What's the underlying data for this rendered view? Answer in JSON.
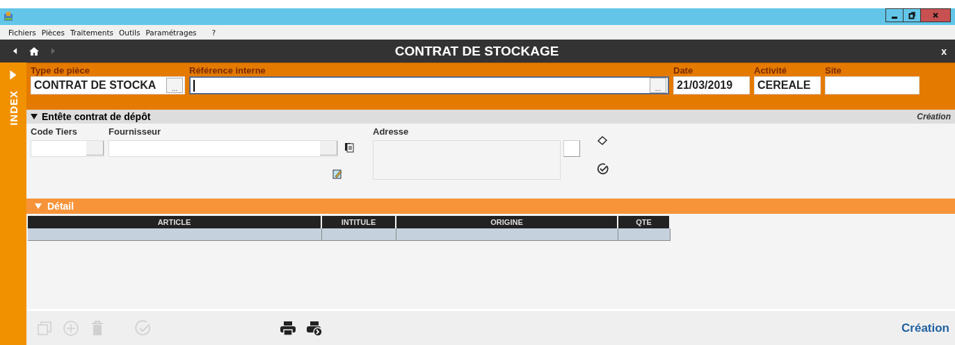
{
  "window": {
    "controls": [
      {
        "kind": "minimize"
      },
      {
        "kind": "restore"
      },
      {
        "kind": "close"
      }
    ]
  },
  "menu": [
    "Fichiers",
    "Pièces",
    "Traitements",
    "Outils",
    "Paramétrages",
    "?"
  ],
  "nav": {
    "back_disabled": false,
    "forward_disabled": true,
    "title": "CONTRAT DE STOCKAGE",
    "close": "x"
  },
  "side_tab": {
    "label": "INDEX"
  },
  "header_fields": [
    {
      "label": "Type de pièce",
      "value": "CONTRAT DE STOCKA",
      "picker": "...",
      "kind": "picker"
    },
    {
      "label": "Référence interne",
      "picker": "...",
      "kind": "focused"
    },
    {
      "label": "Date",
      "value": "21/03/2019",
      "kind": "plain"
    },
    {
      "label": "Activité",
      "value": "CEREALE",
      "kind": "plain"
    },
    {
      "label": "Site",
      "kind": "plain"
    }
  ],
  "section": {
    "title": "Entête contrat de dépôt",
    "expanded": true,
    "mode": "Création",
    "code_tiers": {
      "label": "Code Tiers"
    },
    "fournisseur": {
      "label": "Fournisseur"
    },
    "adresse": {
      "label": "Adresse"
    }
  },
  "detail": {
    "title": "Détail",
    "expanded": true,
    "columns": [
      "ARTICLE",
      "INTITULE",
      "ORIGINE",
      "QTE"
    ]
  },
  "toolbar": [
    {
      "kind": "copy",
      "disabled": true
    },
    {
      "kind": "add",
      "disabled": true
    },
    {
      "kind": "delete",
      "disabled": true
    },
    {
      "kind": "validate",
      "disabled": true
    },
    {
      "kind": "print",
      "disabled": false
    },
    {
      "kind": "print-preview",
      "disabled": false
    }
  ],
  "status": "Création"
}
